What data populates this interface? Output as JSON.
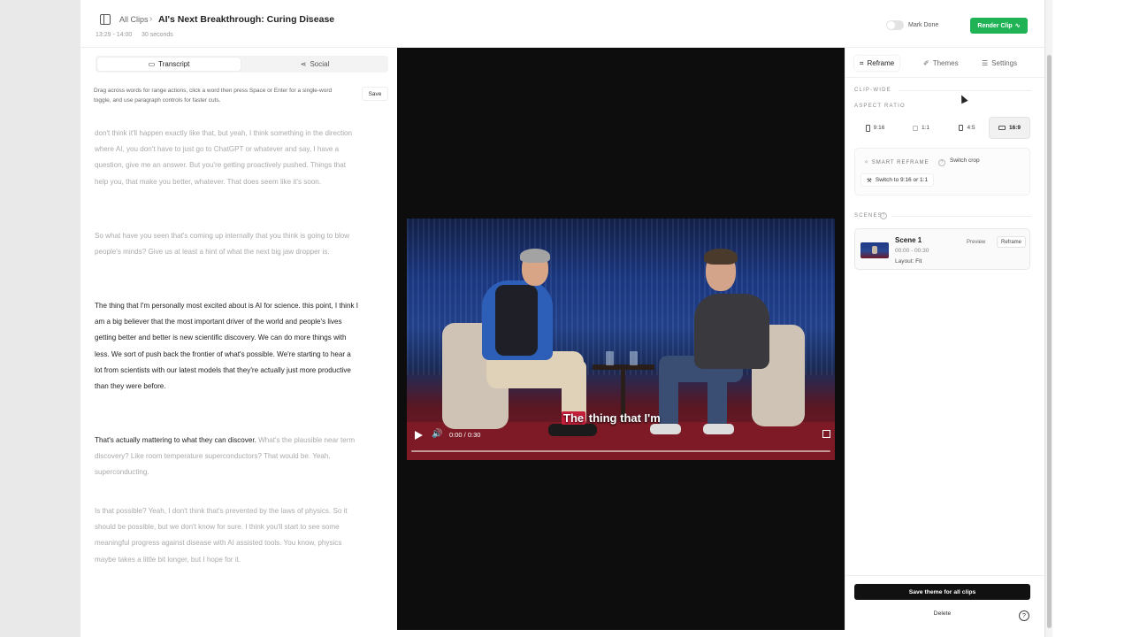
{
  "header": {
    "breadcrumb_root": "All Clips",
    "breadcrumb_sep": "›",
    "title": "AI's Next Breakthrough: Curing Disease",
    "time_range": "13:29 - 14:00",
    "duration": "30 seconds",
    "mark_done_label": "Mark Done",
    "render_label": "Render Clip"
  },
  "left_panel": {
    "tabs": [
      {
        "label": "Transcript",
        "icon": "chat-icon",
        "active": true
      },
      {
        "label": "Social",
        "icon": "share-icon",
        "active": false
      }
    ],
    "help_text": "Drag across words for range actions, click a word then press Space or Enter for a single-word toggle, and use paragraph controls for faster cuts.",
    "save_label": "Save",
    "paragraphs": [
      {
        "light": "don't think it'll happen exactly like that, but yeah, I think something in the direction where AI, you don't have to just go to ChatGPT or whatever and say, I have a question, give me an answer. But you're getting proactively pushed. Things that help you, that make you better, whatever. That does seem like it's soon."
      },
      {
        "light": "So what have you seen that's coming up internally that you think is going to blow people's minds? Give us at least a hint of what the next big jaw dropper is."
      },
      {
        "dark": "The thing that I'm personally most excited about is AI for science. this point, I think I am a big believer that the most important driver of the world and people's lives getting better and better is new scientific discovery. We can do more things with less. We sort of push back the frontier of what's possible. We're starting to hear a lot from scientists with our latest models that they're actually just more productive than they were before."
      },
      {
        "dark": "That's actually mattering to what they can discover.",
        "light": " What's the plausible near term discovery? Like room temperature superconductors? That would be. Yeah, superconducting."
      },
      {
        "light": "Is that possible? Yeah, I don't think that's prevented by the laws of physics. So it should be possible, but we don't know for sure. I think you'll start to see some meaningful progress against disease with AI assisted tools. You know, physics maybe takes a little bit longer, but I hope for it."
      }
    ]
  },
  "video": {
    "subtitle_highlight": "The",
    "subtitle_rest": " thing that I'm",
    "time": "0:00 / 0:30",
    "progress": 0.0,
    "accent_color": "#c41f3a"
  },
  "right_panel": {
    "tabs": [
      {
        "label": "Reframe",
        "icon": "crop-icon",
        "active": true
      },
      {
        "label": "Themes",
        "icon": "brush-icon",
        "active": false
      },
      {
        "label": "Settings",
        "icon": "sliders-icon",
        "active": false
      }
    ],
    "clip_wide_label": "CLIP-WIDE",
    "aspect_ratio_label": "ASPECT RATIO",
    "aspect_ratios": [
      {
        "label": "9:16",
        "active": false
      },
      {
        "label": "1:1",
        "active": false
      },
      {
        "label": "4:5",
        "active": false
      },
      {
        "label": "16:9",
        "active": true
      }
    ],
    "smart_reframe_label": "SMART REFRAME",
    "switch_crop_label": "Switch crop",
    "switch_916_label": "Switch to 9:16 or 1:1",
    "scenes_label": "SCENES",
    "scene": {
      "title": "Scene 1",
      "time": "00:00 - 00:30",
      "layout_label": "Layout:",
      "layout_value": "Fit",
      "preview_label": "Preview",
      "reframe_label": "Reframe"
    },
    "save_theme_label": "Save theme for all clips",
    "delete_label": "Delete",
    "help_glyph": "?"
  },
  "colors": {
    "render_button": "#1fb355",
    "save_theme_button": "#111111"
  }
}
